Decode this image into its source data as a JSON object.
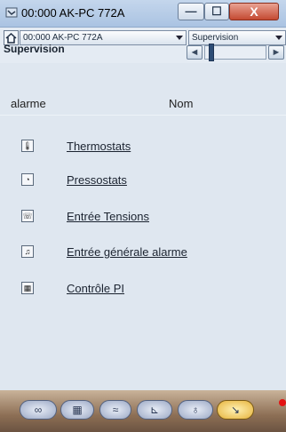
{
  "window": {
    "title": "00:000 AK-PC 772A",
    "min_glyph": "—",
    "max_glyph": "☐",
    "close_glyph": "X"
  },
  "header": {
    "unit_select": "00:000 AK-PC 772A",
    "view_select": "Supervision",
    "section_title": "Supervision",
    "prev_glyph": "◄",
    "next_glyph": "►"
  },
  "table": {
    "columns": [
      "alarme",
      "Nom"
    ],
    "items": [
      {
        "icon": "thermostat-icon",
        "glyph": "🌡",
        "label": "Thermostats"
      },
      {
        "icon": "pressostat-icon",
        "glyph": "◔",
        "label": "Pressostats"
      },
      {
        "icon": "voltage-input-icon",
        "glyph": "☏",
        "label": "Entrée Tensions"
      },
      {
        "icon": "general-alarm-icon",
        "glyph": "♫",
        "label": "Entrée générale alarme"
      },
      {
        "icon": "pi-control-icon",
        "glyph": "▦",
        "label": "Contrôle PI"
      }
    ]
  },
  "toolbar": {
    "buttons": [
      {
        "icon": "overview-icon",
        "glyph": "∞",
        "active": false
      },
      {
        "icon": "grid-icon",
        "glyph": "▦",
        "active": false
      },
      {
        "icon": "fan-icon",
        "glyph": "≈",
        "active": false
      },
      {
        "icon": "graph-icon",
        "glyph": "⊾",
        "active": false
      },
      {
        "icon": "alarm-bell-icon",
        "glyph": "♁",
        "active": false
      },
      {
        "icon": "tools-icon",
        "glyph": "↘",
        "active": true
      }
    ]
  },
  "colors": {
    "accent": "#2d4d76",
    "toolbar_active": "#e6b23b",
    "alarm_dot": "#e41212"
  }
}
